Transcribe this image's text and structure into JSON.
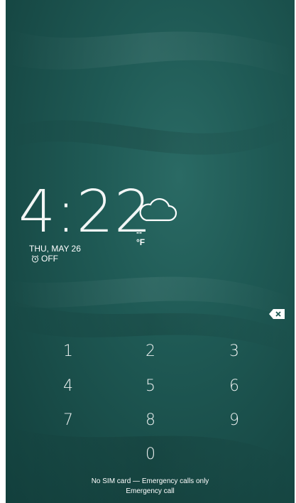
{
  "lockscreen": {
    "time": "4:22",
    "temperature": "--°F",
    "date": "THU, MAY 26",
    "alarm_status": "OFF",
    "weather_icon": "cloud-icon",
    "alarm_icon": "alarm-clock-icon"
  },
  "keypad": {
    "keys": [
      "1",
      "2",
      "3",
      "4",
      "5",
      "6",
      "7",
      "8",
      "9",
      "0"
    ],
    "backspace_icon": "backspace-icon"
  },
  "footer": {
    "sim_status": "No SIM card — Emergency calls only",
    "emergency_call": "Emergency call"
  },
  "colors": {
    "background": "#1f5a55",
    "text": "#ffffff"
  }
}
